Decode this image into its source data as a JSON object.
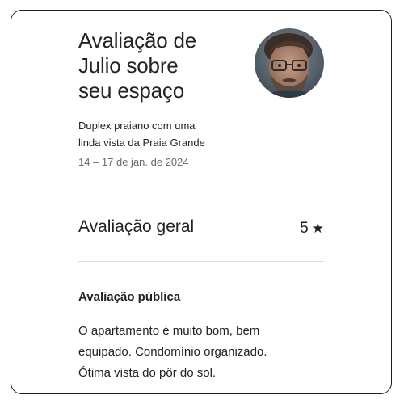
{
  "review": {
    "title": "Avaliação de\nJulio sobre\nseu espaço",
    "listing_name": "Duplex praiano com uma\nlinda vista da Praia Grande",
    "dates": "14 – 17 de jan. de 2024",
    "overall_label": "Avaliação geral",
    "overall_score": "5",
    "star_icon": "star-icon",
    "public_label": "Avaliação pública",
    "public_text": "O apartamento é muito bom, bem\nequipado. Condomínio organizado.\nÓtima vista do pôr do sol."
  },
  "avatar": {
    "icon": "reviewer-avatar"
  }
}
